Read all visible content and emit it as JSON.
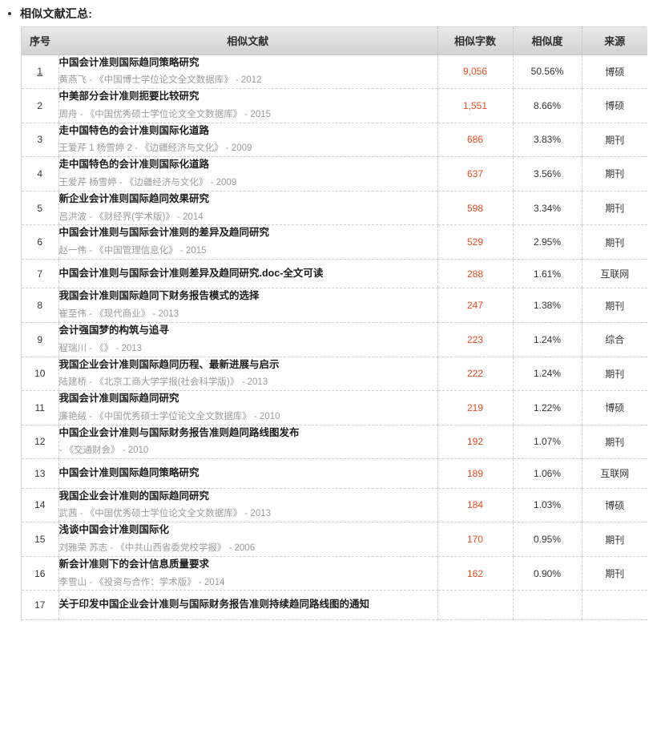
{
  "heading": {
    "bullet_icon": "bullet-dot-icon",
    "text": "相似文献汇总:"
  },
  "table": {
    "columns": [
      {
        "key": "index",
        "label": "序号"
      },
      {
        "key": "document",
        "label": "相似文献"
      },
      {
        "key": "word_count",
        "label": "相似字数"
      },
      {
        "key": "similarity",
        "label": "相似度"
      },
      {
        "key": "source",
        "label": "来源"
      }
    ],
    "accent_color": "#e8491d",
    "header_bg": "#dcdcdc",
    "rows": [
      {
        "index": "1",
        "title": "中国会计准则国际趋同策略研究",
        "meta": "黄燕飞 - 《中国博士学位论文全文数据库》 - 2012",
        "word_count": "9,056",
        "similarity": "50.56%",
        "source": "博硕"
      },
      {
        "index": "2",
        "title": "中美部分会计准则扼要比较研究",
        "meta": "周舟 - 《中国优秀硕士学位论文全文数据库》 - 2015",
        "word_count": "1,551",
        "similarity": "8.66%",
        "source": "博硕"
      },
      {
        "index": "3",
        "title": "走中国特色的会计准则国际化道路",
        "meta": "王爱芹 1 杨雪婷 2 - 《边疆经济与文化》 - 2009",
        "word_count": "686",
        "similarity": "3.83%",
        "source": "期刊"
      },
      {
        "index": "4",
        "title": "走中国特色的会计准则国际化道路",
        "meta": "王爱芹 杨雪婷 - 《边疆经济与文化》 - 2009",
        "word_count": "637",
        "similarity": "3.56%",
        "source": "期刊"
      },
      {
        "index": "5",
        "title": "新企业会计准则国际趋同效果研究",
        "meta": "吕洪波 - 《财经界(学术版)》 - 2014",
        "word_count": "598",
        "similarity": "3.34%",
        "source": "期刊"
      },
      {
        "index": "6",
        "title": "中国会计准则与国际会计准则的差异及趋同研究",
        "meta": "赵一伟 - 《中国管理信息化》 - 2015",
        "word_count": "529",
        "similarity": "2.95%",
        "source": "期刊"
      },
      {
        "index": "7",
        "title": "中国会计准则与国际会计准则差异及趋同研究.doc-全文可读",
        "meta": "",
        "word_count": "288",
        "similarity": "1.61%",
        "source": "互联网"
      },
      {
        "index": "8",
        "title": "我国会计准则国际趋同下财务报告模式的选择",
        "meta": "崔至伟 - 《现代商业》 - 2013",
        "word_count": "247",
        "similarity": "1.38%",
        "source": "期刊"
      },
      {
        "index": "9",
        "title": "会计强国梦的构筑与追寻",
        "meta": "程瑞川 - 《》 - 2013",
        "word_count": "223",
        "similarity": "1.24%",
        "source": "综合"
      },
      {
        "index": "10",
        "title": "我国企业会计准则国际趋同历程、最新进展与启示",
        "meta": "陆建桥 - 《北京工商大学学报(社会科学版)》 - 2013",
        "word_count": "222",
        "similarity": "1.24%",
        "source": "期刊"
      },
      {
        "index": "11",
        "title": "我国会计准则国际趋同研究",
        "meta": "廉艳绒 - 《中国优秀硕士学位论文全文数据库》 - 2010",
        "word_count": "219",
        "similarity": "1.22%",
        "source": "博硕"
      },
      {
        "index": "12",
        "title": "中国企业会计准则与国际财务报告准则趋同路线图发布",
        "meta": "- 《交通财会》 - 2010",
        "word_count": "192",
        "similarity": "1.07%",
        "source": "期刊"
      },
      {
        "index": "13",
        "title": "中国会计准则国际趋同策略研究",
        "meta": "",
        "word_count": "189",
        "similarity": "1.06%",
        "source": "互联网"
      },
      {
        "index": "14",
        "title": "我国企业会计准则的国际趋同研究",
        "meta": "武茜 - 《中国优秀硕士学位论文全文数据库》 - 2013",
        "word_count": "184",
        "similarity": "1.03%",
        "source": "博硕"
      },
      {
        "index": "15",
        "title": "浅谈中国会计准则国际化",
        "meta": "刘雅荣 苏志 - 《中共山西省委党校学报》 - 2006",
        "word_count": "170",
        "similarity": "0.95%",
        "source": "期刊"
      },
      {
        "index": "16",
        "title": "新会计准则下的会计信息质量要求",
        "meta": "李雪山 - 《投资与合作：学术版》 - 2014",
        "word_count": "162",
        "similarity": "0.90%",
        "source": "期刊"
      },
      {
        "index": "17",
        "title": "关于印发中国企业会计准则与国际财务报告准则持续趋同路线图的通知",
        "meta": "",
        "word_count": "",
        "similarity": "",
        "source": ""
      }
    ]
  }
}
